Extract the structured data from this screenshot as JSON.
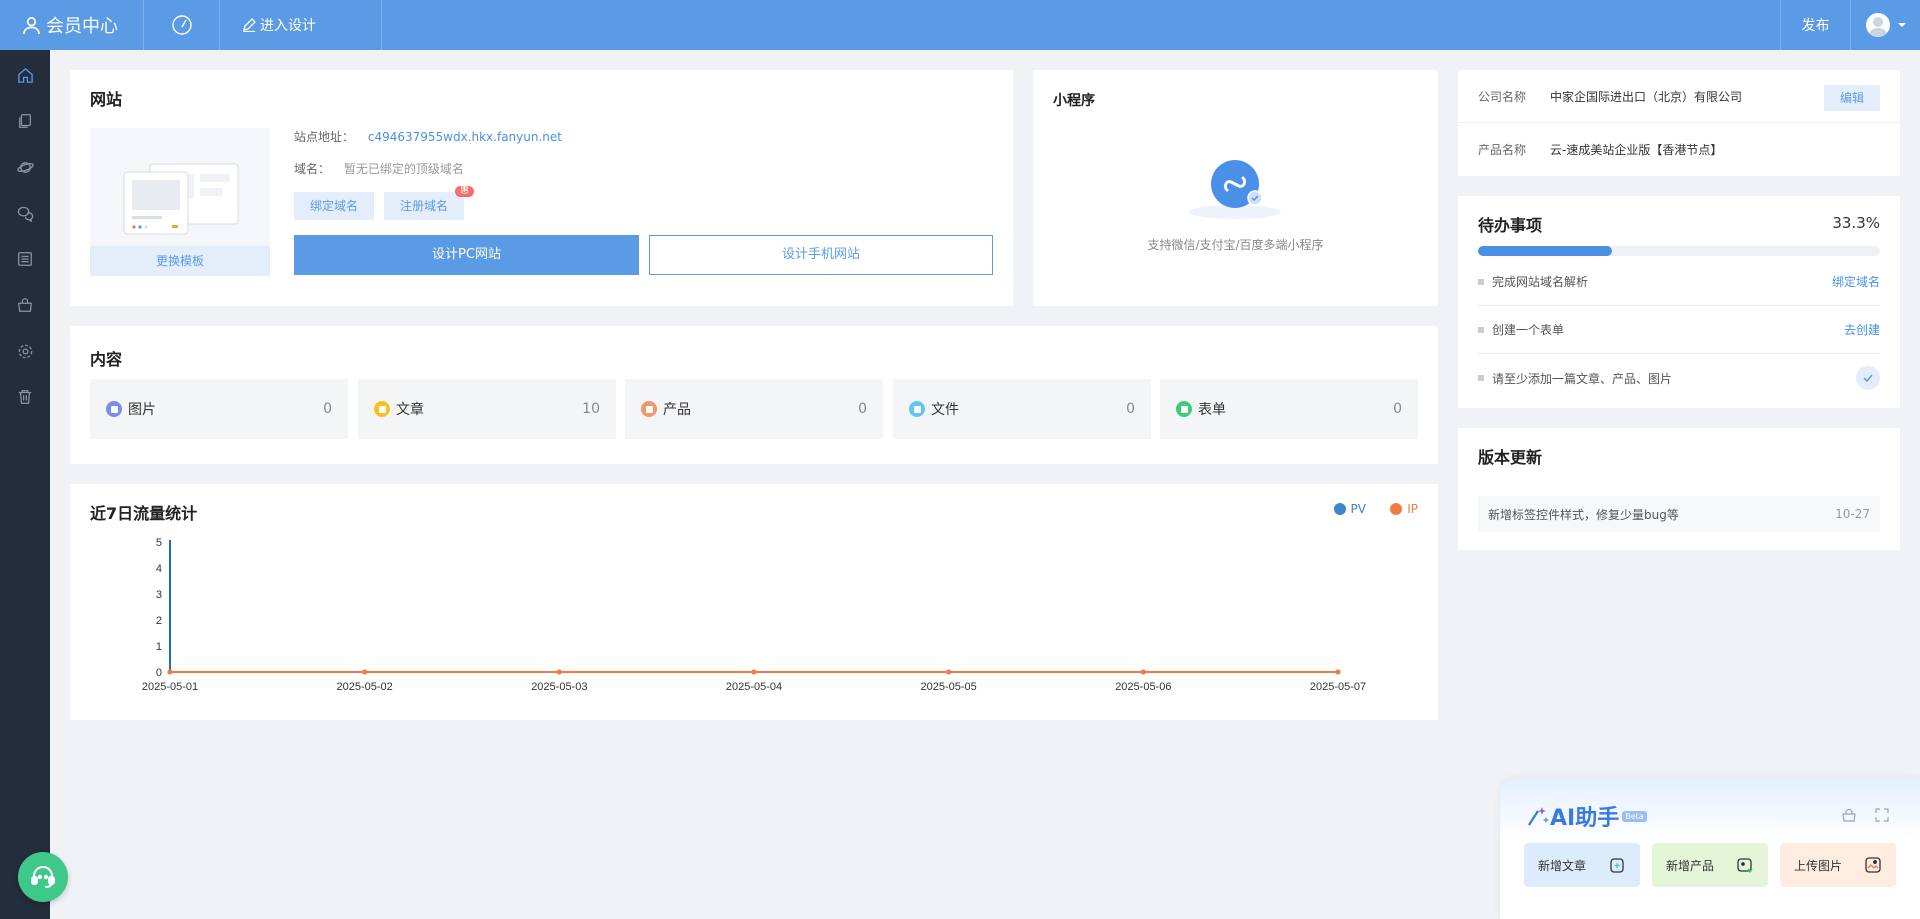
{
  "topbar": {
    "brand": "会员中心",
    "design_label": "进入设计",
    "publish_label": "发布"
  },
  "website": {
    "title": "网站",
    "template_label": "更换模板",
    "site_addr_label": "站点地址：",
    "site_addr_value": "c494637955wdx.hkx.fanyun.net",
    "domain_label": "域名：",
    "domain_value": "暂无已绑定的顶级域名",
    "bind_domain_label": "绑定域名",
    "register_domain_label": "注册域名",
    "register_badge": "惠",
    "design_pc_label": "设计PC网站",
    "design_mobile_label": "设计手机网站"
  },
  "mini": {
    "title": "小程序",
    "desc": "支持微信/支付宝/百度多端小程序"
  },
  "content": {
    "title": "内容",
    "items": [
      {
        "label": "图片",
        "count": "0",
        "color": "#7b8cf5"
      },
      {
        "label": "文章",
        "count": "10",
        "color": "#f5c21f"
      },
      {
        "label": "产品",
        "count": "0",
        "color": "#f5956c"
      },
      {
        "label": "文件",
        "count": "0",
        "color": "#5ec8f0"
      },
      {
        "label": "表单",
        "count": "0",
        "color": "#3ecb7a"
      }
    ]
  },
  "traffic": {
    "title": "近7日流量统计"
  },
  "chart_data": {
    "type": "line",
    "title": "近7日流量统计",
    "categories": [
      "2025-05-01",
      "2025-05-02",
      "2025-05-03",
      "2025-05-04",
      "2025-05-05",
      "2025-05-06",
      "2025-05-07"
    ],
    "series": [
      {
        "name": "PV",
        "values": [
          0,
          0,
          0,
          0,
          0,
          0,
          0
        ],
        "color": "#3a86c8"
      },
      {
        "name": "IP",
        "values": [
          0,
          0,
          0,
          0,
          0,
          0,
          0
        ],
        "color": "#f57a3f"
      }
    ],
    "yticks": [
      "0",
      "1",
      "2",
      "3",
      "4",
      "5"
    ],
    "ylim": [
      0,
      5
    ],
    "legend": "top-right"
  },
  "company": {
    "name_label": "公司名称",
    "name_value": "中家企国际进出口（北京）有限公司",
    "edit_label": "编辑",
    "product_label": "产品名称",
    "product_value": "云-速成美站企业版【香港节点】"
  },
  "todo": {
    "title": "待办事项",
    "percent_text": "33.3%",
    "progress": 0.333,
    "items": [
      {
        "text": "完成网站域名解析",
        "action": "绑定域名"
      },
      {
        "text": "创建一个表单",
        "action": "去创建"
      },
      {
        "text": "请至少添加一篇文章、产品、图片",
        "action": ""
      }
    ]
  },
  "updates": {
    "title": "版本更新",
    "items": [
      {
        "text": "新增标签控件样式，修复少量bug等",
        "date": "10-27"
      }
    ]
  },
  "ai": {
    "title": "AI助手",
    "badge": "Beta",
    "buttons": [
      {
        "label": "新增文章",
        "bg": "#dcecfc"
      },
      {
        "label": "新增产品",
        "bg": "#e4f5d8"
      },
      {
        "label": "上传图片",
        "bg": "#fdecdf"
      }
    ]
  }
}
